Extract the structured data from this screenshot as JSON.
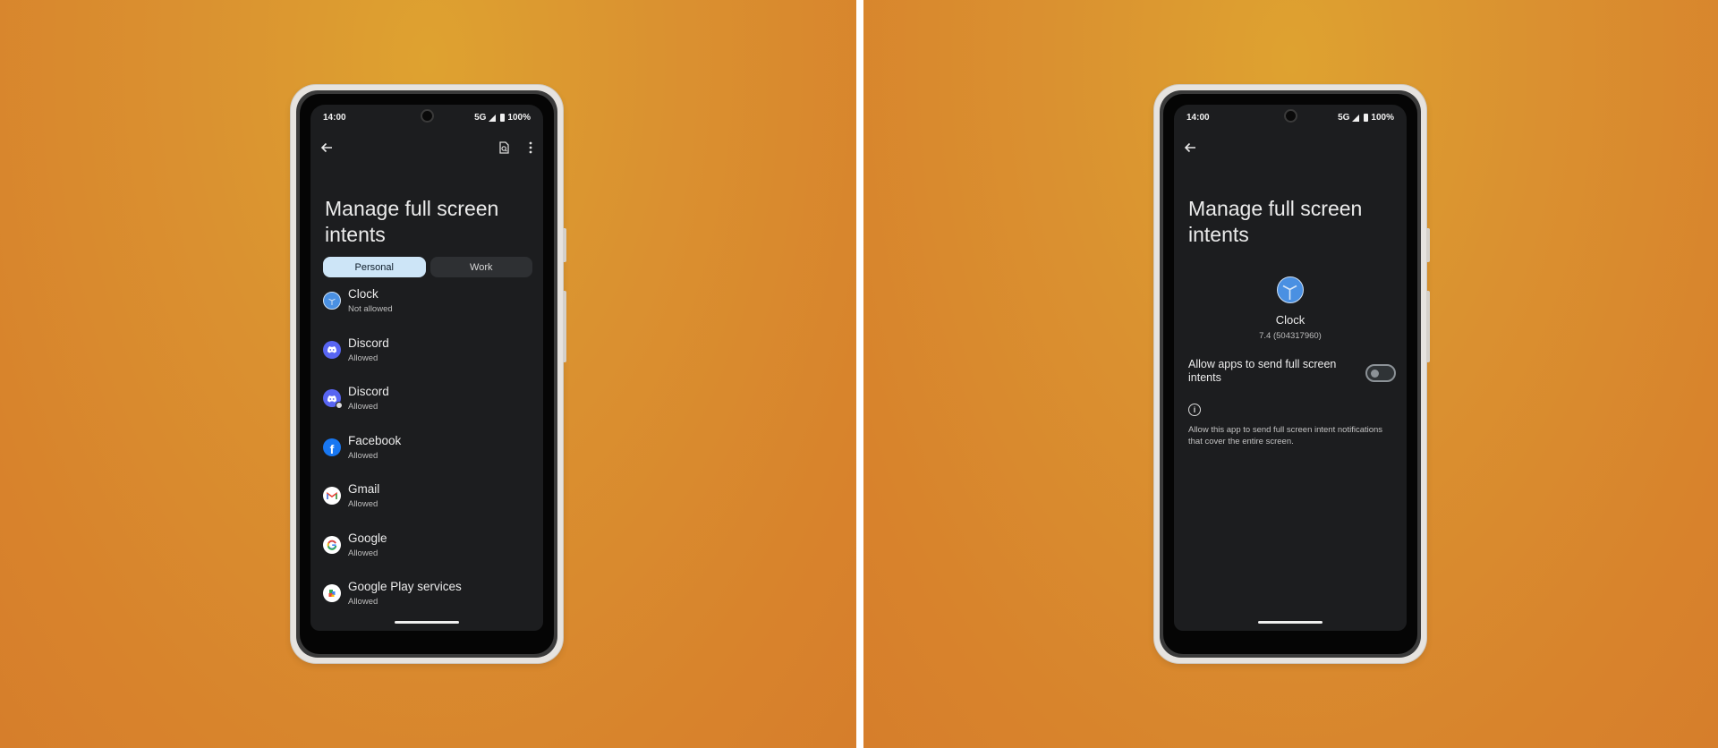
{
  "colors": {
    "background": "#d98a2a",
    "divider": "#ffffff",
    "screen_bg": "#1c1d1f",
    "tab_active_bg": "#cde5f7",
    "tab_inactive_bg": "#2e3033",
    "clock_blue": "#4a90e2",
    "discord_purple": "#5865f2",
    "facebook_blue": "#1877f2"
  },
  "left_phone": {
    "status_bar": {
      "time": "14:00",
      "network": "5G",
      "battery": "100%"
    },
    "app_bar": {
      "back_icon": "arrow-left-icon",
      "search_icon": "search-document-icon",
      "more_icon": "more-vert-icon"
    },
    "title": "Manage full screen intents",
    "tabs": [
      {
        "label": "Personal",
        "active": true
      },
      {
        "label": "Work",
        "active": false
      }
    ],
    "apps": [
      {
        "name": "Clock",
        "status": "Not allowed",
        "icon": "clock-icon"
      },
      {
        "name": "Discord",
        "status": "Allowed",
        "icon": "discord-icon"
      },
      {
        "name": "Discord",
        "status": "Allowed",
        "icon": "discord-work-icon"
      },
      {
        "name": "Facebook",
        "status": "Allowed",
        "icon": "facebook-icon"
      },
      {
        "name": "Gmail",
        "status": "Allowed",
        "icon": "gmail-icon"
      },
      {
        "name": "Google",
        "status": "Allowed",
        "icon": "google-icon"
      },
      {
        "name": "Google Play services",
        "status": "Allowed",
        "icon": "google-play-services-icon"
      }
    ]
  },
  "right_phone": {
    "status_bar": {
      "time": "14:00",
      "network": "5G",
      "battery": "100%"
    },
    "app_bar": {
      "back_icon": "arrow-left-icon"
    },
    "title": "Manage full screen intents",
    "app": {
      "name": "Clock",
      "version": "7.4 (504317960)",
      "icon": "clock-icon"
    },
    "setting": {
      "label": "Allow apps to send full screen intents",
      "enabled": false
    },
    "info": {
      "icon": "info-icon",
      "text": "Allow this app to send full screen intent notifications that cover the entire screen."
    }
  }
}
